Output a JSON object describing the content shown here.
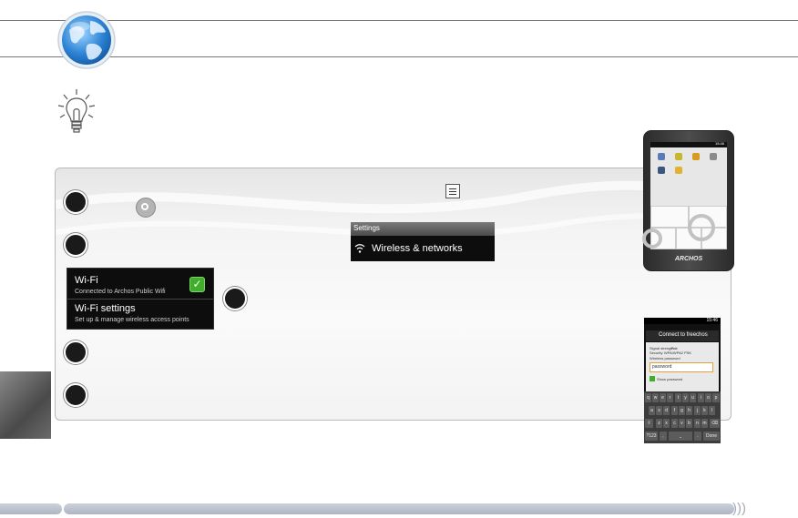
{
  "wifi_panel": {
    "wifi_title": "Wi-Fi",
    "wifi_subtitle": "Connected to Archos Public Wifi",
    "wifi_settings_title": "Wi-Fi settings",
    "wifi_settings_subtitle": "Set up & manage wireless access points"
  },
  "settings_screen": {
    "header": "Settings",
    "item": "Wireless & networks"
  },
  "device": {
    "brand": "ARCHOS",
    "clock": "15:46"
  },
  "connect_dialog": {
    "clock": "15:46",
    "title": "Connect to freechos",
    "signal_label": "Signal strength",
    "signal_value": "Fair",
    "security_label": "Security",
    "security_value": "WPA/WPA2 PSK",
    "password_label": "Wireless password",
    "password_value": "password",
    "show_password": "Show password",
    "keyboard_rows": [
      [
        "q",
        "w",
        "e",
        "r",
        "t",
        "y",
        "u",
        "i",
        "o",
        "p"
      ],
      [
        "a",
        "s",
        "d",
        "f",
        "g",
        "h",
        "j",
        "k",
        "l"
      ],
      [
        "z",
        "x",
        "c",
        "v",
        "b",
        "n",
        "m"
      ]
    ],
    "sym_key": "?123",
    "done_key": "Done"
  },
  "colors": {
    "step_circle": "#1a1a1a",
    "bottom_bar": "#b8bfcb",
    "check_green": "#3fae2a",
    "password_border": "#e2a040"
  },
  "icons": {
    "globe": "globe-icon",
    "tip": "lightbulb-icon",
    "settings": "gear-icon",
    "menu": "menu-icon",
    "wifi": "wifi-icon"
  }
}
